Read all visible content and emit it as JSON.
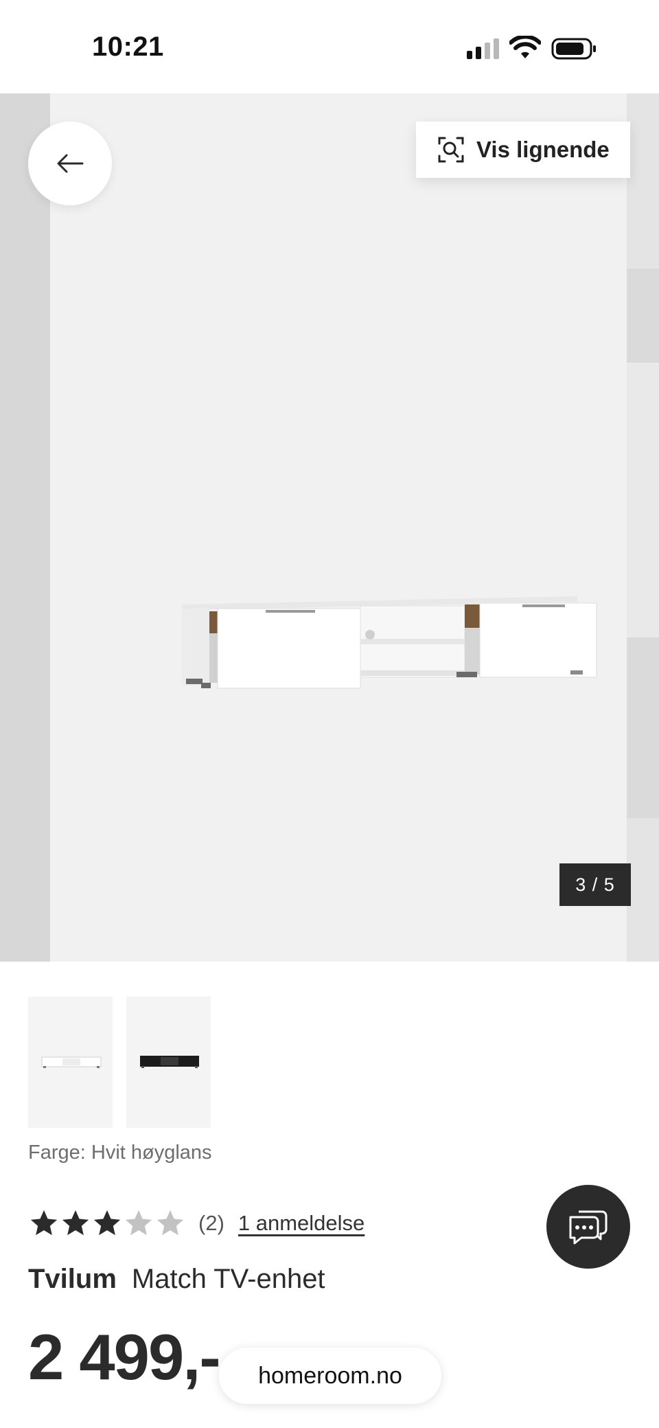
{
  "status_bar": {
    "time": "10:21",
    "icons": [
      "cellular-signal-icon",
      "wifi-icon",
      "battery-icon"
    ]
  },
  "gallery": {
    "back_icon": "arrow-left-icon",
    "similar_button": {
      "icon": "visual-search-icon",
      "label": "Vis lignende"
    },
    "counter": "3 / 5",
    "current_image": 3,
    "total_images": 5
  },
  "thumbnails": [
    {
      "name": "white-variant",
      "color": "#ffffff"
    },
    {
      "name": "black-variant",
      "color": "#1c1c1c"
    }
  ],
  "product": {
    "color_label": "Farge: Hvit høyglans",
    "rating": {
      "value": 3,
      "max": 5,
      "count_text": "(2)",
      "reviews_link": "1 anmeldelse"
    },
    "brand": "Tvilum",
    "name": "Match TV-enhet",
    "price": "2 499,-"
  },
  "chat_button": {
    "icon": "chat-bubbles-icon"
  },
  "browser": {
    "url": "homeroom.no"
  },
  "colors": {
    "dark": "#2b2b2b",
    "star_filled": "#2b2b2b",
    "star_empty": "#c2c2c2",
    "image_bg": "#f1f1f2"
  }
}
